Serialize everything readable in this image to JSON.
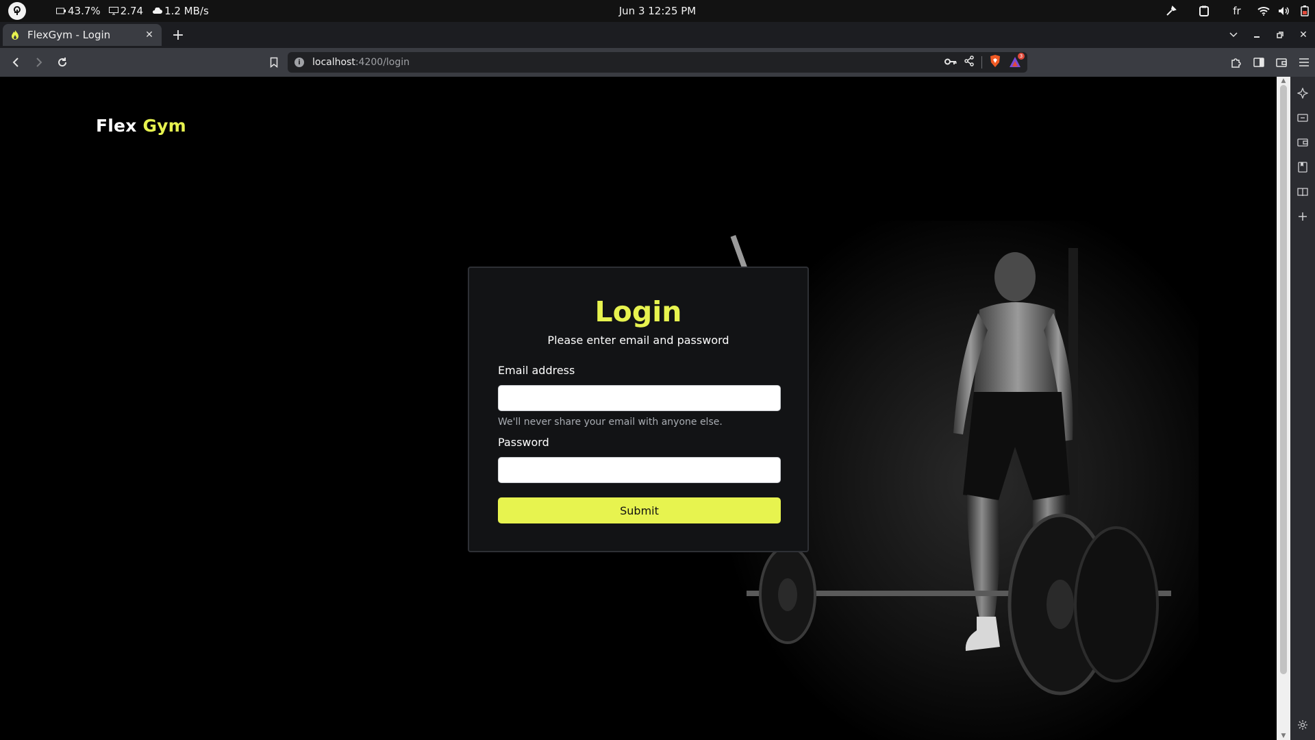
{
  "os_bar": {
    "stats": {
      "battery": "43.7%",
      "load": "2.74",
      "network": "1.2 MB/s"
    },
    "clock": "Jun 3  12:25 PM",
    "keyboard_layout": "fr"
  },
  "browser": {
    "tab": {
      "title": "FlexGym - Login",
      "favicon": "flame-icon"
    },
    "address": {
      "host": "localhost",
      "path": ":4200/login"
    },
    "rewards_badge": "3"
  },
  "page": {
    "brand": {
      "part1": "Flex",
      "part2": "Gym"
    },
    "login": {
      "title": "Login",
      "subtitle": "Please enter email and password",
      "email_label": "Email address",
      "email_value": "",
      "email_help": "We'll never share your email with anyone else.",
      "password_label": "Password",
      "password_value": "",
      "submit_label": "Submit"
    }
  },
  "colors": {
    "accent": "#e7f34f",
    "background": "#000000",
    "card": "#121315"
  }
}
